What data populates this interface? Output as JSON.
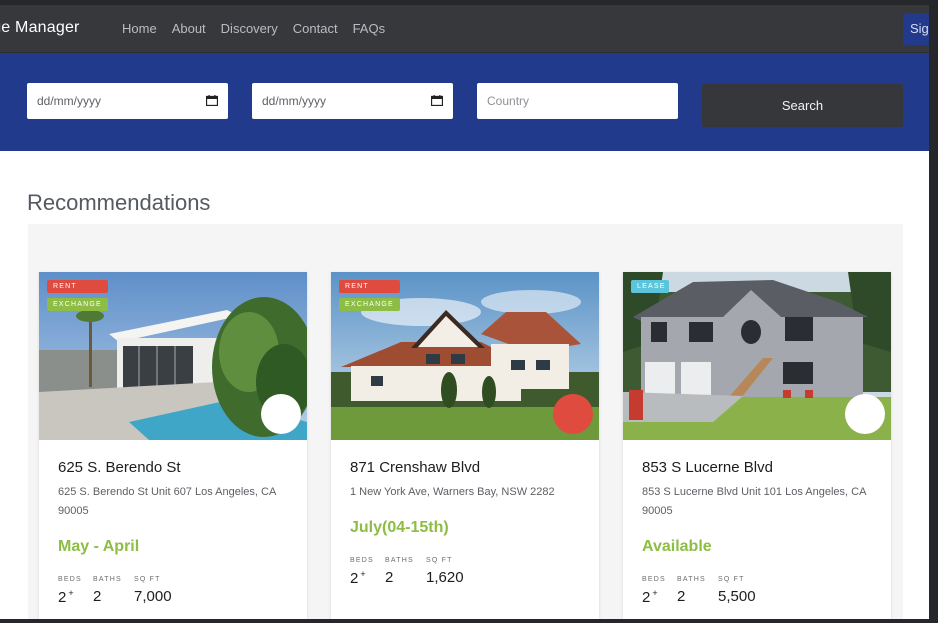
{
  "navbar": {
    "brand": "ange Manager",
    "links": [
      "Home",
      "About",
      "Discovery",
      "Contact",
      "FAQs"
    ],
    "signin_label": "Sig"
  },
  "search": {
    "date_from_placeholder": "dd/mm/yyyy",
    "date_to_placeholder": "dd/mm/yyyy",
    "country_placeholder": "Country",
    "button_label": "Search"
  },
  "section": {
    "title": "Recommendations"
  },
  "labels": {
    "beds": "BEDS",
    "baths": "BATHS",
    "sqft": "SQ FT"
  },
  "cards": [
    {
      "tags": [
        "RENT",
        "EXCHANGE"
      ],
      "title": "625 S. Berendo St",
      "address": "625 S. Berendo St Unit 607 Los Angeles, CA 90005",
      "availability": "May - April",
      "beds": "2",
      "beds_plus": "+",
      "baths": "2",
      "sqft": "7,000",
      "favorite": false
    },
    {
      "tags": [
        "RENT",
        "EXCHANGE"
      ],
      "title": "871 Crenshaw Blvd",
      "address": "1 New York Ave, Warners Bay, NSW 2282",
      "availability": "July(04-15th)",
      "beds": "2",
      "beds_plus": "+",
      "baths": "2",
      "sqft": "1,620",
      "favorite": true
    },
    {
      "tags": [
        "LEASE"
      ],
      "title": "853 S Lucerne Blvd",
      "address": "853 S Lucerne Blvd Unit 101 Los Angeles, CA 90005",
      "availability": "Available",
      "beds": "2",
      "beds_plus": "+",
      "baths": "2",
      "sqft": "5,500",
      "favorite": false
    }
  ],
  "colors": {
    "navbar_bg": "#37383c",
    "search_band_bg": "#223a8c",
    "accent_green": "#8dbd44",
    "accent_red": "#e04b3f",
    "lease_blue": "#5bc6db"
  },
  "icons": {
    "date_picker": "calendar-icon",
    "favorite": "heart-toggle"
  }
}
